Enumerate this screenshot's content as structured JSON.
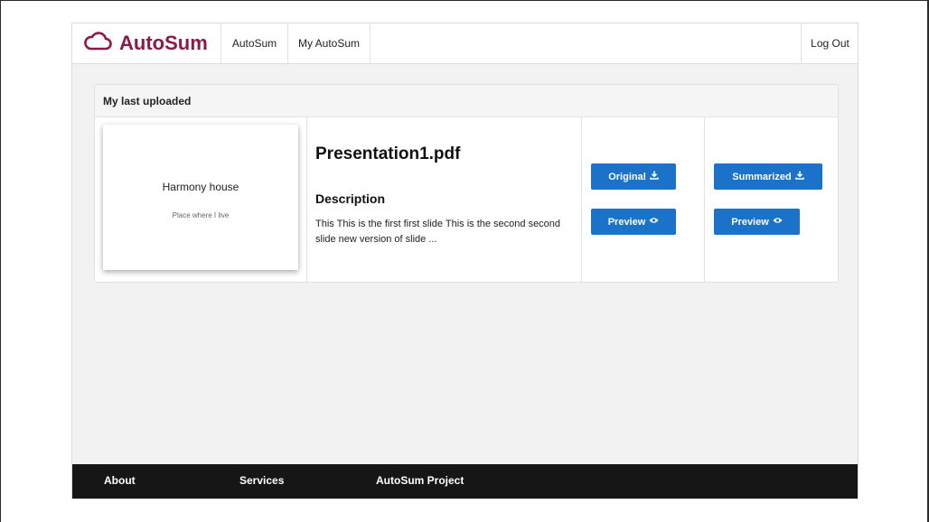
{
  "brand": {
    "name": "AutoSum",
    "color": "#8b1a4a"
  },
  "nav": {
    "autosum_label": "AutoSum",
    "my_autosum_label": "My AutoSum",
    "logout_label": "Log Out"
  },
  "panel": {
    "title": "My last uploaded",
    "thumbnail": {
      "title": "Harmony house",
      "subtitle": "Place where I live"
    },
    "file_name": "Presentation1.pdf",
    "description_heading": "Description",
    "description_text": "This This is the first first slide This is the second second slide new version of slide ..."
  },
  "buttons": {
    "original_label": "Original",
    "original_preview_label": "Preview",
    "summarized_label": "Summarized",
    "summarized_preview_label": "Preview",
    "color": "#1a73c9"
  },
  "footer": {
    "about_label": "About",
    "services_label": "Services",
    "project_label": "AutoSum Project"
  },
  "icons": [
    "cloud-icon",
    "download-icon",
    "eye-icon"
  ]
}
